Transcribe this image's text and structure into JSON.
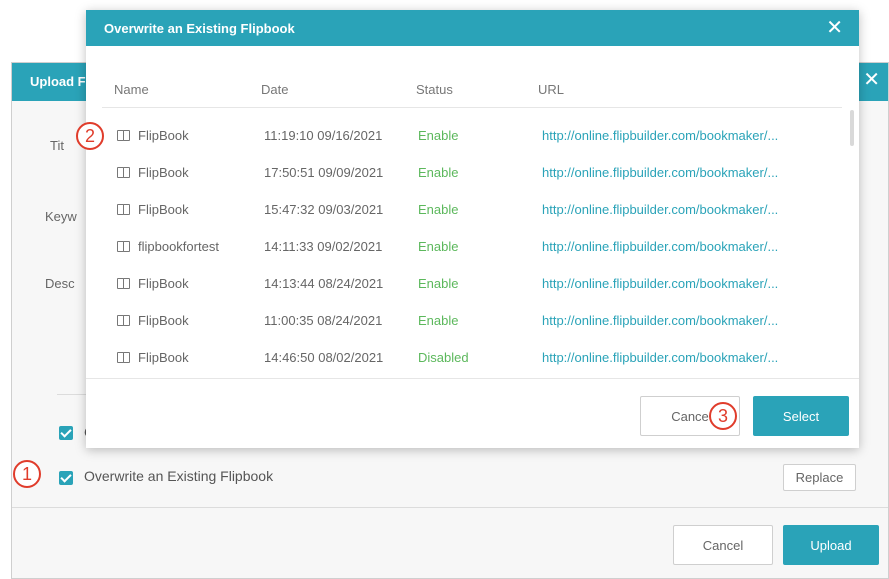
{
  "bg": {
    "title": "Upload F",
    "labels": {
      "title": "Tit",
      "keywords": "Keyw",
      "description": "Desc"
    },
    "opt1_label": "C",
    "opt2_label": "Overwrite an Existing Flipbook",
    "replace_label": "Replace",
    "cancel_label": "Cancel",
    "upload_label": "Upload"
  },
  "modal": {
    "title": "Overwrite an Existing Flipbook",
    "columns": [
      "Name",
      "Date",
      "Status",
      "URL"
    ],
    "rows": [
      {
        "name": "FlipBook",
        "date": "11:19:10 09/16/2021",
        "status": "Enable",
        "url": "http://online.flipbuilder.com/bookmaker/..."
      },
      {
        "name": "FlipBook",
        "date": "17:50:51 09/09/2021",
        "status": "Enable",
        "url": "http://online.flipbuilder.com/bookmaker/..."
      },
      {
        "name": "FlipBook",
        "date": "15:47:32 09/03/2021",
        "status": "Enable",
        "url": "http://online.flipbuilder.com/bookmaker/..."
      },
      {
        "name": "flipbookfortest",
        "date": "14:11:33 09/02/2021",
        "status": "Enable",
        "url": "http://online.flipbuilder.com/bookmaker/..."
      },
      {
        "name": "FlipBook",
        "date": "14:13:44 08/24/2021",
        "status": "Enable",
        "url": "http://online.flipbuilder.com/bookmaker/..."
      },
      {
        "name": "FlipBook",
        "date": "11:00:35 08/24/2021",
        "status": "Enable",
        "url": "http://online.flipbuilder.com/bookmaker/..."
      },
      {
        "name": "FlipBook",
        "date": "14:46:50 08/02/2021",
        "status": "Disabled",
        "url": "http://online.flipbuilder.com/bookmaker/..."
      }
    ],
    "cancel_label": "Cance",
    "select_label": "Select"
  },
  "markers": [
    "1",
    "2",
    "3"
  ],
  "colors": {
    "accent": "#2aa3b8",
    "status_ok": "#5cb85c",
    "marker": "#e03c2b"
  }
}
